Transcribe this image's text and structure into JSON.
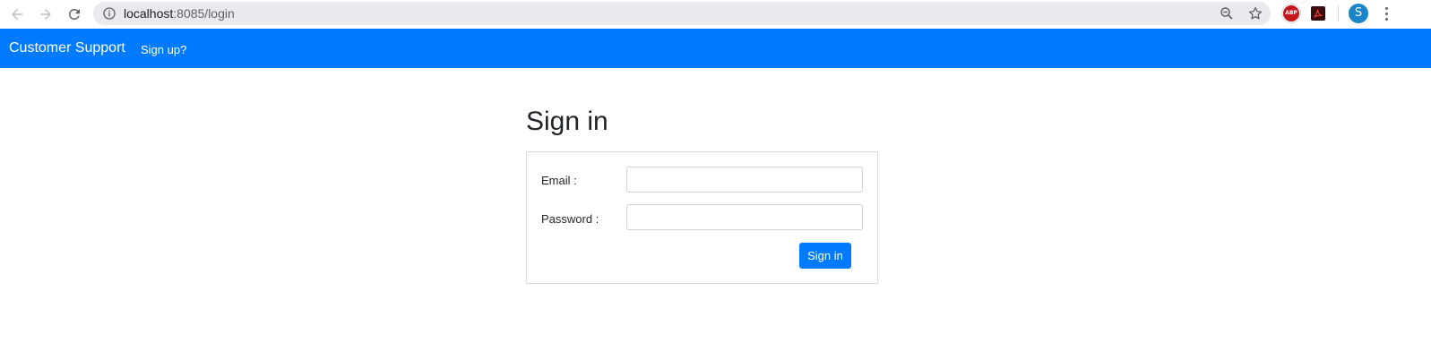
{
  "browser": {
    "url_host": "localhost",
    "url_path": ":8085/login",
    "avatar_letter": "S",
    "extensions": {
      "abp_label": "ABP",
      "pdf_icon": "acrobat-icon"
    }
  },
  "navbar": {
    "brand": "Customer Support",
    "signup_link": "Sign up?"
  },
  "page": {
    "title": "Sign in"
  },
  "form": {
    "email_label": "Email :",
    "email_value": "",
    "password_label": "Password :",
    "password_value": "",
    "submit_label": "Sign in"
  },
  "colors": {
    "primary": "#007bff",
    "avatar": "#1a86c9",
    "abp": "#c4161c"
  }
}
